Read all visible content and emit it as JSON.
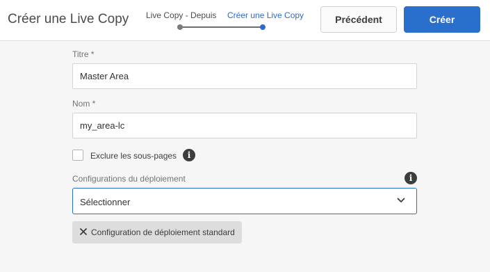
{
  "header": {
    "title": "Créer une Live Copy",
    "steps": [
      {
        "label": "Live Copy - Depuis",
        "state": "done"
      },
      {
        "label": "Créer une Live Copy",
        "state": "current"
      }
    ],
    "previous_label": "Précédent",
    "create_label": "Créer"
  },
  "form": {
    "title_field": {
      "label": "Titre *",
      "value": "Master Area"
    },
    "name_field": {
      "label": "Nom *",
      "value": "my_area-lc"
    },
    "exclude_subpages": {
      "label": "Exclure les sous-pages",
      "checked": false
    },
    "rollout_configs": {
      "label": "Configurations du déploiement",
      "selected": "Sélectionner",
      "tags": [
        "Configuration de déploiement standard"
      ]
    }
  },
  "icons": {
    "info": "info-icon",
    "chevron": "chevron-down-icon",
    "remove": "close-icon"
  },
  "colors": {
    "accent": "#2b6fcd",
    "background": "#f6f6f6",
    "header_bg": "#ffffff",
    "tag_bg": "#dddddd"
  }
}
